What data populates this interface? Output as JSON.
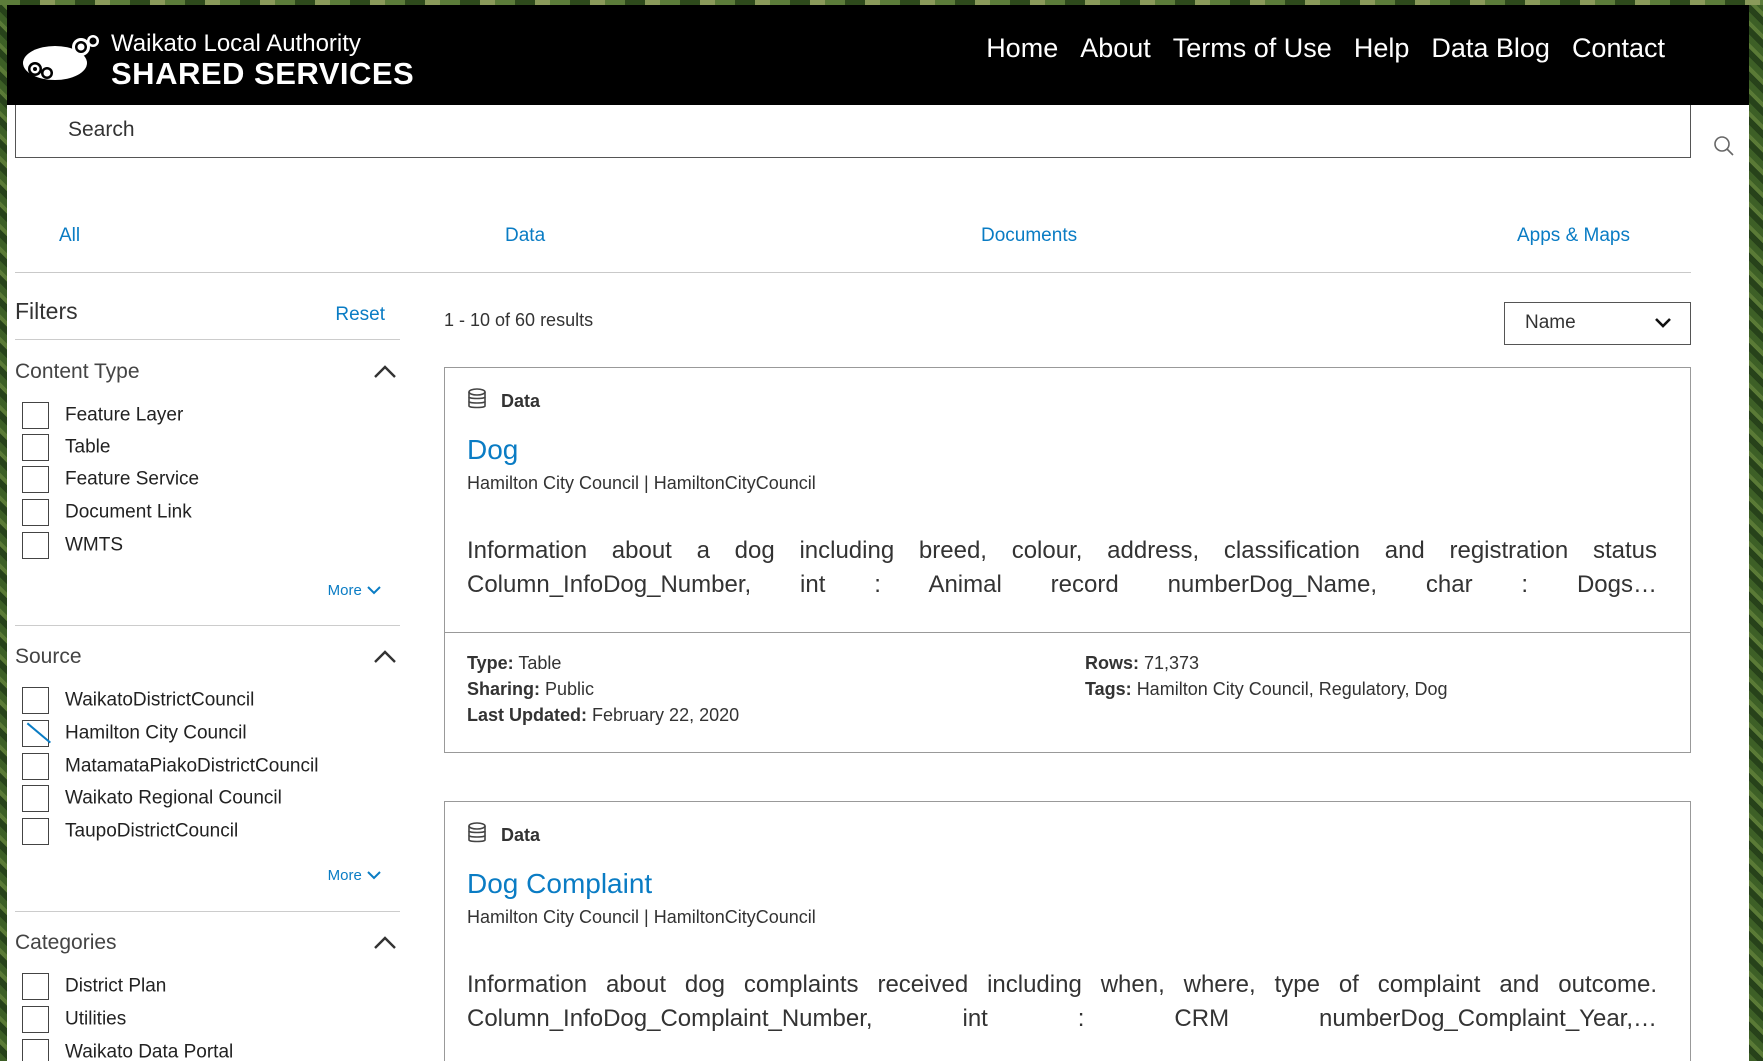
{
  "header": {
    "logo_line1": "Waikato Local Authority",
    "logo_line2": "SHARED SERVICES",
    "nav": [
      "Home",
      "About",
      "Terms of Use",
      "Help",
      "Data Blog",
      "Contact"
    ]
  },
  "search": {
    "placeholder": "Search"
  },
  "tabs": [
    "All",
    "Data",
    "Documents",
    "Apps & Maps"
  ],
  "filters": {
    "title": "Filters",
    "reset": "Reset",
    "content_type": {
      "title": "Content Type",
      "items": [
        "Feature Layer",
        "Table",
        "Feature Service",
        "Document Link",
        "WMTS"
      ],
      "more": "More"
    },
    "source": {
      "title": "Source",
      "items": [
        "WaikatoDistrictCouncil",
        "Hamilton City Council",
        "MatamataPiakoDistrictCouncil",
        "Waikato Regional Council",
        "TaupoDistrictCouncil"
      ],
      "checked": "Hamilton City Council",
      "more": "More"
    },
    "categories": {
      "title": "Categories",
      "items": [
        "District Plan",
        "Utilities",
        "Waikato Data Portal"
      ]
    }
  },
  "results": {
    "count": "1 - 10 of 60 results",
    "sort": "Name",
    "cards": [
      {
        "type": "Data",
        "title": "Dog",
        "owner": "Hamilton City Council | HamiltonCityCouncil",
        "description": "Information about a dog including breed, colour, address, classification and registration status Column_InfoDog_Number, int : Animal record numberDog_Name, char : Dogs…",
        "type_label": "Type:",
        "type_value": "Table",
        "sharing_label": "Sharing:",
        "sharing_value": "Public",
        "updated_label": "Last Updated:",
        "updated_value": "February 22, 2020",
        "rows_label": "Rows:",
        "rows_value": "71,373",
        "tags_label": "Tags:",
        "tags_value": "Hamilton City Council, Regulatory, Dog"
      },
      {
        "type": "Data",
        "title": "Dog Complaint",
        "owner": "Hamilton City Council | HamiltonCityCouncil",
        "description": "Information about dog complaints received including when, where, type of complaint and outcome. Column_InfoDog_Complaint_Number, int : CRM numberDog_Complaint_Year,…"
      }
    ]
  },
  "colors": {
    "accent": "#0a7cc4",
    "header_bg": "#000000"
  },
  "icons": [
    "search-icon",
    "chevron-up-icon",
    "chevron-down-icon",
    "database-icon",
    "logo-icon"
  ]
}
